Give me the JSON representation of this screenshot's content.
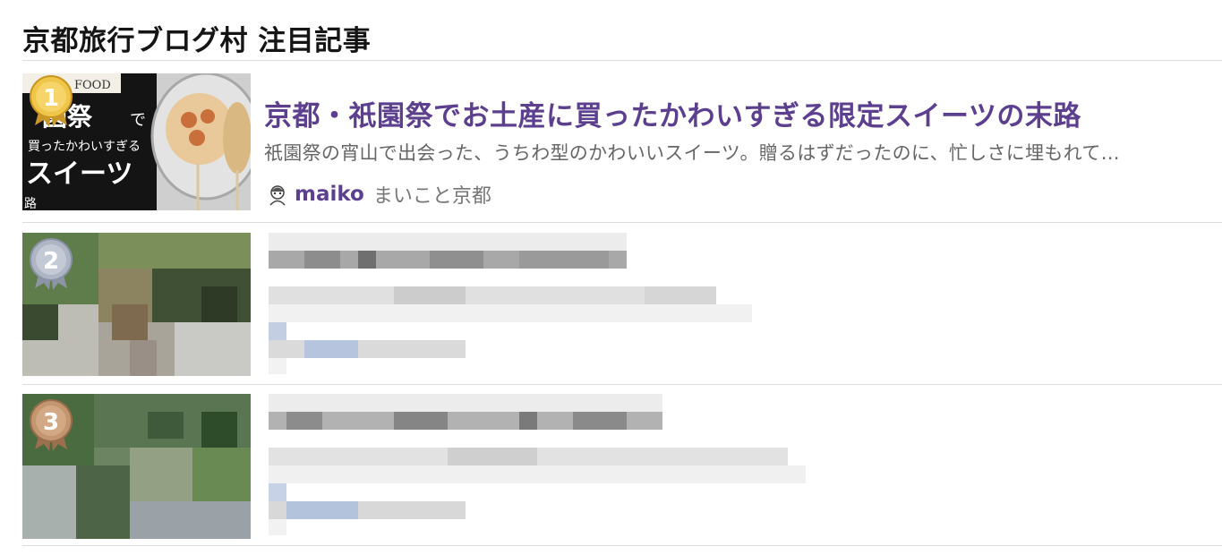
{
  "widget": {
    "title": "京都旅行ブログ村 注目記事"
  },
  "items": [
    {
      "rank": "1",
      "thumb_text": [
        "園祭",
        "で",
        "買ったかわいすぎる",
        "スイーツ",
        "路",
        "FOOD"
      ],
      "title": "京都・祇園祭でお土産に買ったかわいすぎる限定スイーツの末路",
      "excerpt": "祇園祭の宵山で出会った、うちわ型のかわいいスイーツ。贈るはずだったのに、忙しさに埋もれて…",
      "author": "maiko",
      "blog": "まいこと京都",
      "badge_color": "#e8b93a"
    },
    {
      "rank": "2",
      "badge_color": "#9aa3b4"
    },
    {
      "rank": "3",
      "badge_color": "#b8896a"
    }
  ]
}
